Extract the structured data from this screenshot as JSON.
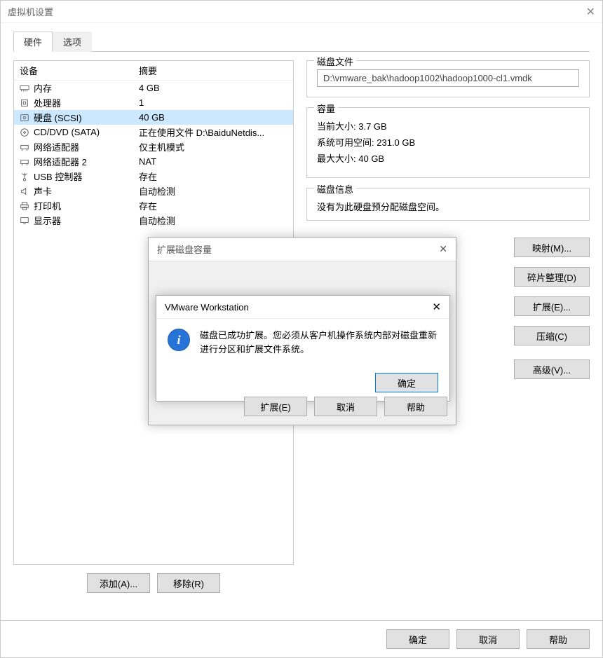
{
  "window": {
    "title": "虚拟机设置"
  },
  "tabs": {
    "hardware": "硬件",
    "options": "选项"
  },
  "deviceList": {
    "header": {
      "device": "设备",
      "summary": "摘要"
    },
    "rows": [
      {
        "icon": "memory",
        "name": "内存",
        "summary": "4 GB",
        "selected": false
      },
      {
        "icon": "cpu",
        "name": "处理器",
        "summary": "1",
        "selected": false
      },
      {
        "icon": "disk",
        "name": "硬盘 (SCSI)",
        "summary": "40 GB",
        "selected": true
      },
      {
        "icon": "cd",
        "name": "CD/DVD (SATA)",
        "summary": "正在使用文件 D:\\BaiduNetdis...",
        "selected": false
      },
      {
        "icon": "net",
        "name": "网络适配器",
        "summary": "仅主机模式",
        "selected": false
      },
      {
        "icon": "net",
        "name": "网络适配器 2",
        "summary": "NAT",
        "selected": false
      },
      {
        "icon": "usb",
        "name": "USB 控制器",
        "summary": "存在",
        "selected": false
      },
      {
        "icon": "sound",
        "name": "声卡",
        "summary": "自动检测",
        "selected": false
      },
      {
        "icon": "printer",
        "name": "打印机",
        "summary": "存在",
        "selected": false
      },
      {
        "icon": "display",
        "name": "显示器",
        "summary": "自动检测",
        "selected": false
      }
    ]
  },
  "leftButtons": {
    "add": "添加(A)...",
    "remove": "移除(R)"
  },
  "right": {
    "diskFile": {
      "title": "磁盘文件",
      "value": "D:\\vmware_bak\\hadoop1002\\hadoop1000-cl1.vmdk"
    },
    "capacity": {
      "title": "容量",
      "currentLabel": "当前大小:",
      "currentValue": "3.7 GB",
      "freeLabel": "系统可用空间:",
      "freeValue": "231.0 GB",
      "maxLabel": "最大大小:",
      "maxValue": "40 GB"
    },
    "diskInfo": {
      "title": "磁盘信息",
      "line1": "没有为此硬盘预分配磁盘空间。"
    },
    "buttons": {
      "map": "映射(M)...",
      "defrag": "碎片整理(D)",
      "expand": "扩展(E)...",
      "compress": "压缩(C)",
      "advanced": "高级(V)..."
    }
  },
  "bottom": {
    "ok": "确定",
    "cancel": "取消",
    "help": "帮助"
  },
  "dialog1": {
    "title": "扩展磁盘容量",
    "buttons": {
      "expand": "扩展(E)",
      "cancel": "取消",
      "help": "帮助"
    }
  },
  "dialog2": {
    "title": "VMware Workstation",
    "message": "磁盘已成功扩展。您必须从客户机操作系统内部对磁盘重新进行分区和扩展文件系统。",
    "ok": "确定"
  }
}
